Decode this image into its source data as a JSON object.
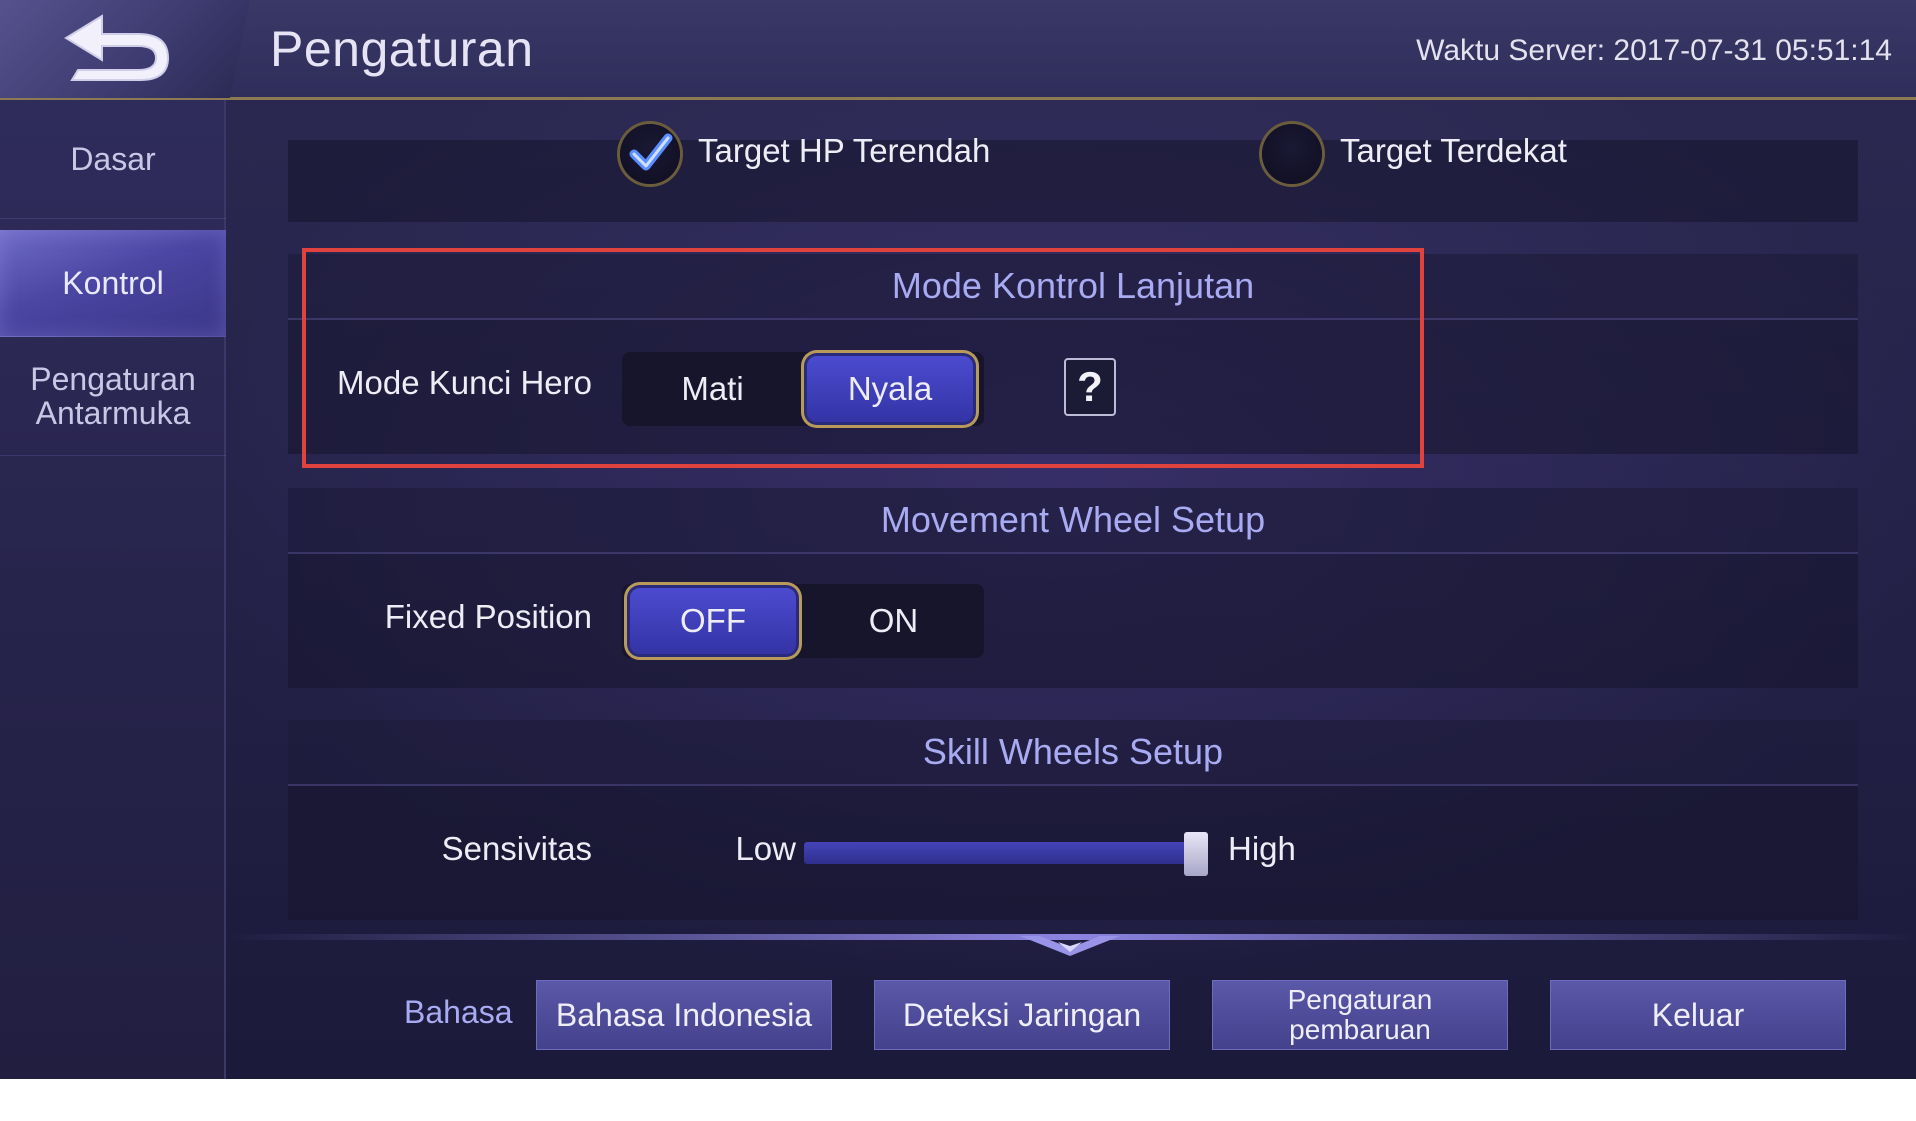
{
  "header": {
    "title": "Pengaturan",
    "server_time": "Waktu Server: 2017-07-31 05:51:14"
  },
  "sidebar": {
    "items": [
      {
        "label": "Dasar",
        "active": false
      },
      {
        "label": "Kontrol",
        "active": true
      },
      {
        "label": "Pengaturan Antarmuka",
        "active": false
      }
    ]
  },
  "targeting": {
    "option_lowest_hp": "Target HP Terendah",
    "option_nearest": "Target Terdekat",
    "selected": "Target HP Terendah"
  },
  "advanced_control": {
    "title": "Mode Kontrol Lanjutan",
    "row_label": "Mode Kunci Hero",
    "options": [
      "Mati",
      "Nyala"
    ],
    "selected": "Nyala",
    "help_icon": "question-icon"
  },
  "movement_wheel": {
    "title": "Movement Wheel Setup",
    "row_label": "Fixed Position",
    "options": [
      "OFF",
      "ON"
    ],
    "selected": "OFF"
  },
  "skill_wheels": {
    "title": "Skill Wheels Setup",
    "row_label": "Sensivitas",
    "low_label": "Low",
    "high_label": "High",
    "value_fraction": 0.98
  },
  "footer": {
    "language_label": "Bahasa",
    "language_button": "Bahasa Indonesia",
    "network_button": "Deteksi Jaringan",
    "update_button": "Pengaturan pembaruan",
    "exit_button": "Keluar"
  },
  "colors": {
    "accent": "#3a3aae",
    "highlight_box": "#e0423e",
    "section_title": "#a9abf2",
    "gold_trim": "#b89a5a"
  }
}
